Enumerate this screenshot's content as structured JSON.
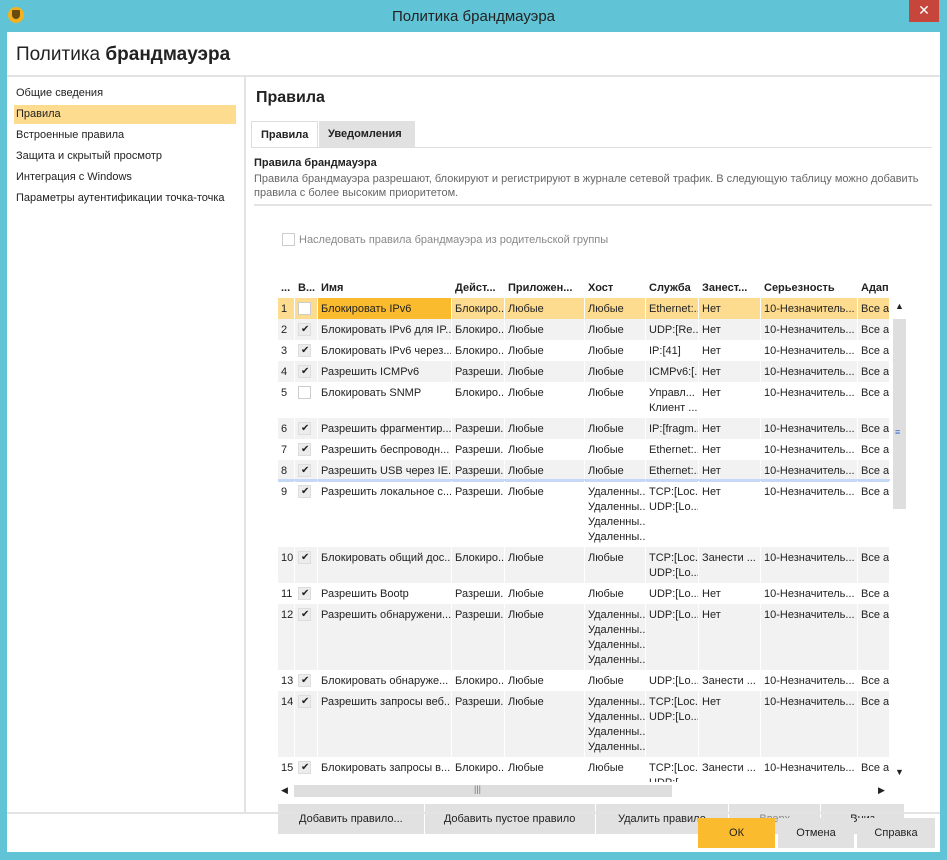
{
  "window": {
    "title": "Политика брандмауэра",
    "close": "✕"
  },
  "header": {
    "prefix": "Политика",
    "bold": "брандмауэра"
  },
  "sidebar": {
    "items": [
      {
        "label": "Общие сведения",
        "selected": false
      },
      {
        "label": "Правила",
        "selected": true
      },
      {
        "label": "Встроенные правила",
        "selected": false
      },
      {
        "label": "Защита и скрытый просмотр",
        "selected": false
      },
      {
        "label": "Интеграция с Windows",
        "selected": false
      },
      {
        "label": "Параметры аутентификации точка-точка",
        "selected": false
      }
    ]
  },
  "main": {
    "title": "Правила",
    "tabs": [
      "Правила",
      "Уведомления"
    ],
    "section_title": "Правила брандмауэра",
    "description": "Правила брандмауэра разрешают, блокируют и регистрируют в журнале сетевой трафик. В следующую таблицу можно добавить правила с более высоким приоритетом.",
    "inherit_label": "Наследовать правила брандмауэра из родительской группы"
  },
  "table": {
    "columns": [
      "...",
      "В...",
      "Имя",
      "Дейст...",
      "Приложен...",
      "Хост",
      "Служба",
      "Занест...",
      "Серьезность",
      "Адап"
    ],
    "rows": [
      {
        "n": "1",
        "on": false,
        "name": "Блокировать IPv6",
        "action": "Блокиро...",
        "app": "Любые",
        "host": [
          "Любые"
        ],
        "service": [
          "Ethernet:..."
        ],
        "log": "Нет",
        "sev": "10-Незначитель...",
        "adapter": "Все ад",
        "selected": true
      },
      {
        "n": "2",
        "on": true,
        "name": "Блокировать IPv6 для IP...",
        "action": "Блокиро...",
        "app": "Любые",
        "host": [
          "Любые"
        ],
        "service": [
          "UDP:[Re..."
        ],
        "log": "Нет",
        "sev": "10-Незначитель...",
        "adapter": "Все ад"
      },
      {
        "n": "3",
        "on": true,
        "name": "Блокировать IPv6 через...",
        "action": "Блокиро...",
        "app": "Любые",
        "host": [
          "Любые"
        ],
        "service": [
          "IP:[41]"
        ],
        "log": "Нет",
        "sev": "10-Незначитель...",
        "adapter": "Все ад"
      },
      {
        "n": "4",
        "on": true,
        "name": "Разрешить ICMPv6",
        "action": "Разреши...",
        "app": "Любые",
        "host": [
          "Любые"
        ],
        "service": [
          "ICMPv6:[..."
        ],
        "log": "Нет",
        "sev": "10-Незначитель...",
        "adapter": "Все ад"
      },
      {
        "n": "5",
        "on": false,
        "name": "Блокировать SNMP",
        "action": "Блокиро...",
        "app": "Любые",
        "host": [
          "Любые"
        ],
        "service": [
          "Управл...",
          "Клиент ..."
        ],
        "log": "Нет",
        "sev": "10-Незначитель...",
        "adapter": "Все ад"
      },
      {
        "n": "6",
        "on": true,
        "name": "Разрешить фрагментир...",
        "action": "Разреши...",
        "app": "Любые",
        "host": [
          "Любые"
        ],
        "service": [
          "IP:[fragm..."
        ],
        "log": "Нет",
        "sev": "10-Незначитель...",
        "adapter": "Все ад"
      },
      {
        "n": "7",
        "on": true,
        "name": "Разрешить беспроводн...",
        "action": "Разреши...",
        "app": "Любые",
        "host": [
          "Любые"
        ],
        "service": [
          "Ethernet:..."
        ],
        "log": "Нет",
        "sev": "10-Незначитель...",
        "adapter": "Все ад"
      },
      {
        "n": "8",
        "on": true,
        "name": "Разрешить USB через IE...",
        "action": "Разреши...",
        "app": "Любые",
        "host": [
          "Любые"
        ],
        "service": [
          "Ethernet:..."
        ],
        "log": "Нет",
        "sev": "10-Незначитель...",
        "adapter": "Все ад"
      },
      {
        "n": "9",
        "on": true,
        "name": "Разрешить локальное с...",
        "action": "Разреши...",
        "app": "Любые",
        "host": [
          "Удаленны...",
          "Удаленны...",
          "Удаленны...",
          "Удаленны..."
        ],
        "service": [
          "TCP:[Loc...",
          "UDP:[Lo..."
        ],
        "log": "Нет",
        "sev": "10-Незначитель...",
        "adapter": "Все ад"
      },
      {
        "n": "10",
        "on": true,
        "name": "Блокировать общий дос...",
        "action": "Блокиро...",
        "app": "Любые",
        "host": [
          "Любые"
        ],
        "service": [
          "TCP:[Loc...",
          "UDP:[Lo..."
        ],
        "log": "Занести ...",
        "sev": "10-Незначитель...",
        "adapter": "Все ад"
      },
      {
        "n": "11",
        "on": true,
        "name": "Разрешить Bootp",
        "action": "Разреши...",
        "app": "Любые",
        "host": [
          "Любые"
        ],
        "service": [
          "UDP:[Lo..."
        ],
        "log": "Нет",
        "sev": "10-Незначитель...",
        "adapter": "Все ад"
      },
      {
        "n": "12",
        "on": true,
        "name": "Разрешить обнаружени...",
        "action": "Разреши...",
        "app": "Любые",
        "host": [
          "Удаленны...",
          "Удаленны...",
          "Удаленны...",
          "Удаленны..."
        ],
        "service": [
          "UDP:[Lo..."
        ],
        "log": "Нет",
        "sev": "10-Незначитель...",
        "adapter": "Все ад"
      },
      {
        "n": "13",
        "on": true,
        "name": "Блокировать обнаруже...",
        "action": "Блокиро...",
        "app": "Любые",
        "host": [
          "Любые"
        ],
        "service": [
          "UDP:[Lo..."
        ],
        "log": "Занести ...",
        "sev": "10-Незначитель...",
        "adapter": "Все ад"
      },
      {
        "n": "14",
        "on": true,
        "name": "Разрешить запросы веб...",
        "action": "Разреши...",
        "app": "Любые",
        "host": [
          "Удаленны...",
          "Удаленны...",
          "Удаленны...",
          "Удаленны..."
        ],
        "service": [
          "TCP:[Loc...",
          "UDP:[Lo..."
        ],
        "log": "Нет",
        "sev": "10-Незначитель...",
        "adapter": "Все ад"
      },
      {
        "n": "15",
        "on": true,
        "name": "Блокировать запросы в...",
        "action": "Блокиро...",
        "app": "Любые",
        "host": [
          "Любые"
        ],
        "service": [
          "TCP:[Loc...",
          "UDP:[..."
        ],
        "log": "Занести ...",
        "sev": "10-Незначитель...",
        "adapter": "Все ад"
      }
    ]
  },
  "buttons": {
    "add": "Добавить правило...",
    "add_empty": "Добавить пустое правило",
    "delete": "Удалить правило",
    "up": "Вверх",
    "down": "Вниз"
  },
  "footer": {
    "ok": "ОК",
    "cancel": "Отмена",
    "help": "Справка"
  },
  "colors": {
    "titlebar": "#60c3d6",
    "accent": "#fbbb2e",
    "selection": "#fedc8f"
  }
}
